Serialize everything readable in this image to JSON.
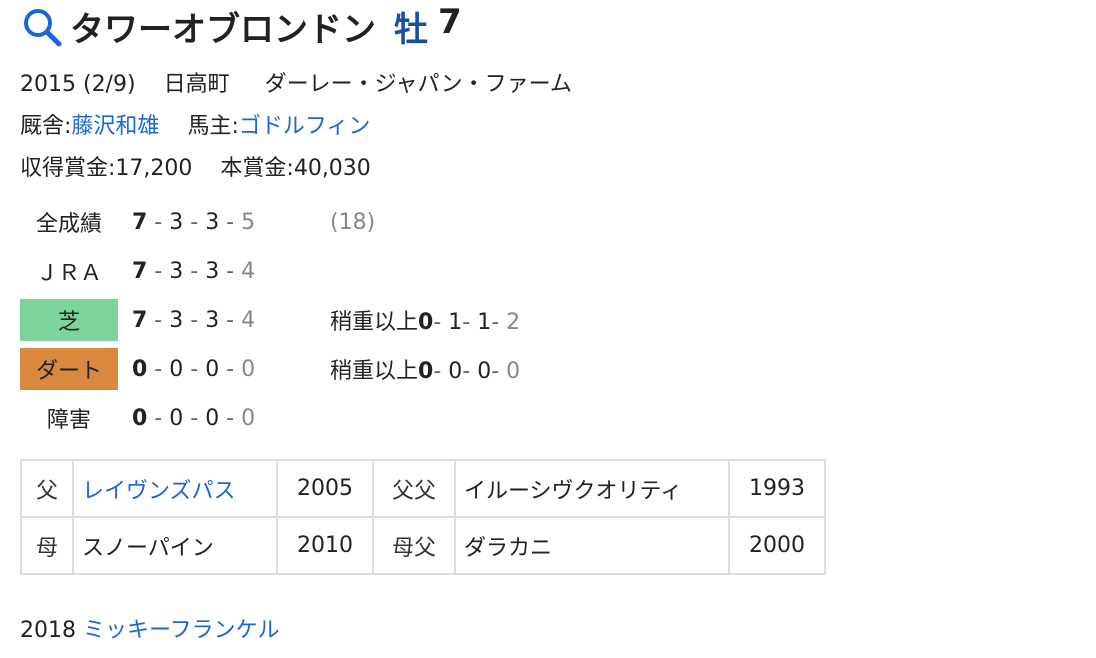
{
  "title": {
    "name": "タワーオブロンドン",
    "sex": "牡",
    "age": "7"
  },
  "profile": {
    "birth": "2015 (2/9)",
    "area": "日高町",
    "breeder": "ダーレー・ジャパン・ファーム",
    "trainer_label": "厩舎:",
    "trainer": "藤沢和雄",
    "owner_label": "馬主:",
    "owner": "ゴドルフィン",
    "earnings_label": "収得賞金:17,200",
    "prize_label": "本賞金:40,030"
  },
  "records": [
    {
      "label": "全成績",
      "w": "7",
      "s": "3",
      "t": "3",
      "f": "5",
      "extra": "(18)"
    },
    {
      "label": "ＪＲＡ",
      "w": "7",
      "s": "3",
      "t": "3",
      "f": "4"
    },
    {
      "label": "芝",
      "w": "7",
      "s": "3",
      "t": "3",
      "f": "4",
      "heavy_label": "稍重以上",
      "hw": "0",
      "hs": "1",
      "ht": "1",
      "hf": "2"
    },
    {
      "label": "ダート",
      "w": "0",
      "s": "0",
      "t": "0",
      "f": "0",
      "heavy_label": "稍重以上",
      "hw": "0",
      "hs": "0",
      "ht": "0",
      "hf": "0"
    },
    {
      "label": "障害",
      "w": "0",
      "s": "0",
      "t": "0",
      "f": "0"
    }
  ],
  "pedigree": {
    "rows": [
      {
        "rel": "父",
        "name": "レイヴンズパス",
        "year": "2005",
        "rel2": "父父",
        "name2": "イルーシヴクオリティ",
        "year2": "1993"
      },
      {
        "rel": "母",
        "name": "スノーパイン",
        "year": "2010",
        "rel2": "母父",
        "name2": "ダラカニ",
        "year2": "2000"
      }
    ]
  },
  "offspring": {
    "year": "2018",
    "name": "ミッキーフランケル"
  },
  "colors": {
    "link": "#1a66d6",
    "sex": "#1a4fa0",
    "turf": "#7dd49a",
    "dirt": "#d9893f"
  }
}
